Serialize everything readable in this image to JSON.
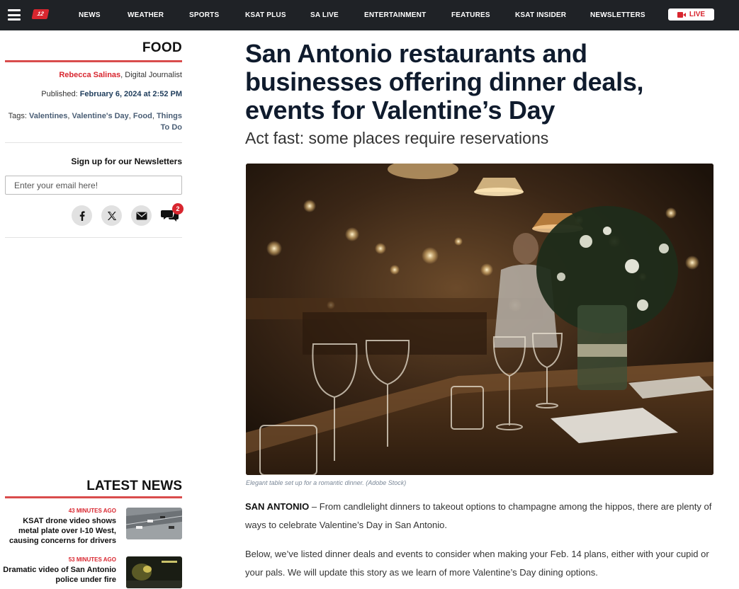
{
  "nav": {
    "logo_text": "12",
    "items": [
      "NEWS",
      "WEATHER",
      "SPORTS",
      "KSAT PLUS",
      "SA LIVE",
      "ENTERTAINMENT",
      "FEATURES",
      "KSAT INSIDER",
      "NEWSLETTERS"
    ],
    "live_label": "LIVE"
  },
  "sidebar": {
    "section": "FOOD",
    "author_name": "Rebecca Salinas",
    "author_role": ", Digital Journalist",
    "published_label": "Published: ",
    "published_date": "February 6, 2024 at 2:52 PM",
    "tags_label": "Tags: ",
    "tags": [
      "Valentines",
      "Valentine's Day",
      "Food",
      "Things To Do"
    ],
    "newsletter_title": "Sign up for our Newsletters",
    "email_placeholder": "Enter your email here!",
    "comment_count": "2",
    "latest_title": "LATEST NEWS",
    "latest": [
      {
        "time": "43 MINUTES AGO",
        "headline": "KSAT drone video shows metal plate over I-10 West, causing concerns for drivers"
      },
      {
        "time": "53 MINUTES AGO",
        "headline": "Dramatic video of San Antonio police under fire"
      }
    ]
  },
  "article": {
    "headline": "San Antonio restaurants and businesses offering dinner deals, events for Valentine’s Day",
    "subhead": "Act fast: some places require reservations",
    "caption": "Elegant table set up for a romantic dinner. (Adobe Stock)",
    "p1_dateline": "SAN ANTONIO",
    "p1_text": " – From candlelight dinners to takeout options to champagne among the hippos, there are plenty of ways to celebrate Valentine’s Day in San Antonio.",
    "p2_text": "Below, we’ve listed dinner deals and events to consider when making your Feb. 14 plans, either with your cupid or your pals. We will update this story as we learn of more Valentine’s Day dining options."
  },
  "colors": {
    "nav_bg": "#1f2226",
    "accent_red": "#d8262f",
    "headline_navy": "#0f1b2d"
  }
}
